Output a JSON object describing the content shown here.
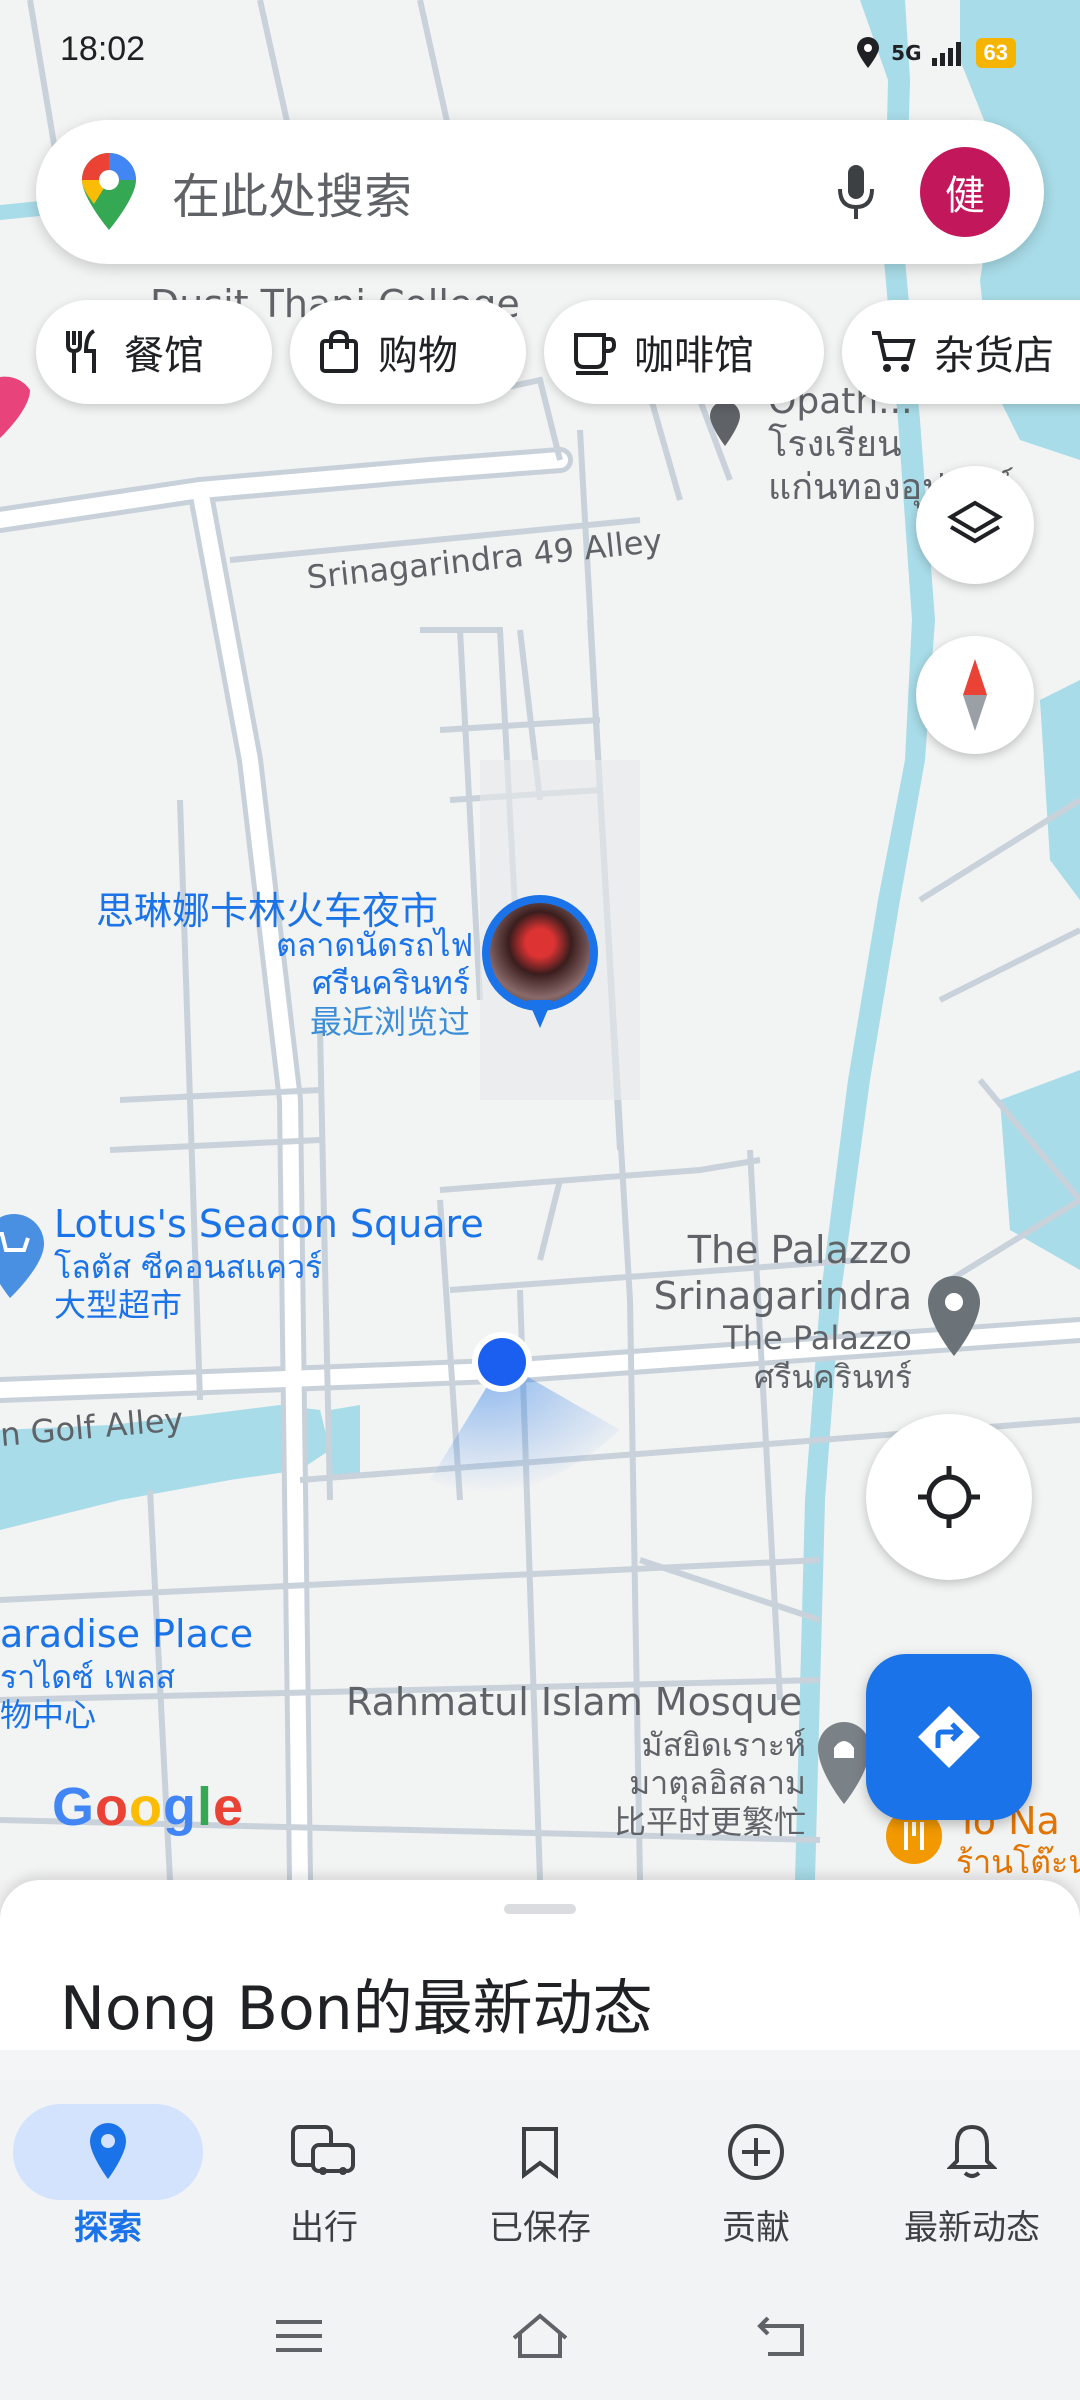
{
  "status_bar": {
    "time": "18:02",
    "network": "5G",
    "battery": "63"
  },
  "search": {
    "placeholder": "在此处搜索",
    "avatar_initial": "健"
  },
  "chips": [
    {
      "label": "餐馆",
      "icon": "restaurant-icon"
    },
    {
      "label": "购物",
      "icon": "shopping-bag-icon"
    },
    {
      "label": "咖啡馆",
      "icon": "coffee-icon"
    },
    {
      "label": "杂货店",
      "icon": "cart-icon"
    }
  ],
  "map": {
    "street_srinagarindra": "Srinagarindra 49 Alley",
    "street_golf": "n Golf Alley",
    "college_partial": "Dusit Thani College",
    "school_partial": "Opath...",
    "school_thai_1": "โรงเรียน",
    "school_thai_2": "แก่นทองอุปถัมภ์",
    "night_market_cn": "思琳娜卡林火车夜市",
    "night_market_th1": "ตลาดนัดรถไฟ",
    "night_market_th2": "ศรีนครินทร์",
    "night_market_note": "最近浏览过",
    "lotus_en": "Lotus's Seacon Square",
    "lotus_th": "โลตัส ซีคอนสแควร์",
    "lotus_cn": "大型超市",
    "palazzo_en1": "The Palazzo",
    "palazzo_en2": "Srinagarindra",
    "palazzo_th1": "The Palazzo",
    "palazzo_th2": "ศรีนครินทร์",
    "paradise_en": "aradise Place",
    "paradise_th": "ราไดซ์ เพลส",
    "paradise_cn": "物中心",
    "mosque_en": "Rahmatul Islam Mosque",
    "mosque_th1": "มัสยิดเราะห์",
    "mosque_th2": "มาตุลอิสลาม",
    "mosque_note": "比平时更繁忙",
    "tona_en": "To Na",
    "tona_th": "ร้านโต๊ะน",
    "google_logo": "Google"
  },
  "sheet": {
    "title": "Nong Bon的最新动态"
  },
  "bottom_nav": [
    {
      "label": "探索",
      "icon": "explore-pin-icon",
      "active": true
    },
    {
      "label": "出行",
      "icon": "commute-icon",
      "active": false
    },
    {
      "label": "已保存",
      "icon": "bookmark-icon",
      "active": false
    },
    {
      "label": "贡献",
      "icon": "add-circle-icon",
      "active": false
    },
    {
      "label": "最新动态",
      "icon": "bell-icon",
      "active": false
    }
  ],
  "colors": {
    "accent": "#1a73e8",
    "water": "#a8dce8",
    "avatar": "#c2185b",
    "battery": "#f4b400"
  }
}
